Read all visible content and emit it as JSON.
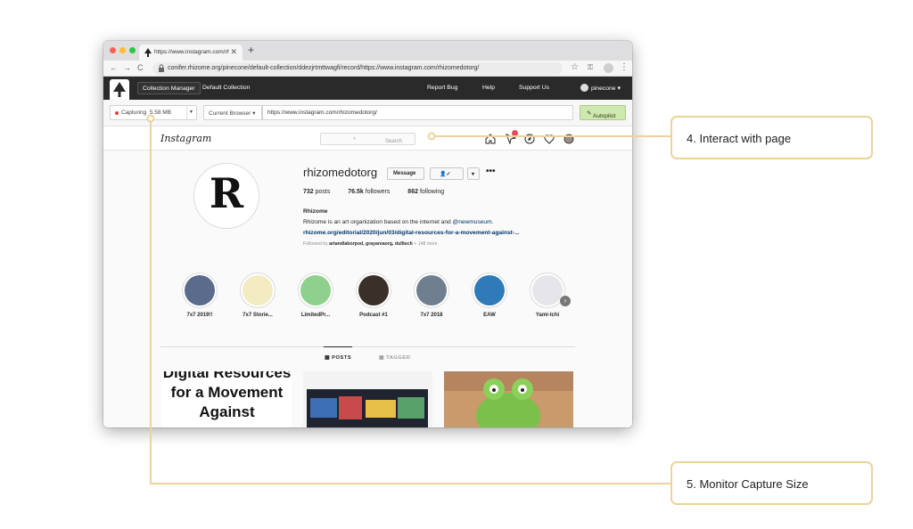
{
  "browser": {
    "tab_title": "https://www.instagram.com/rh",
    "tab_close": "✕",
    "new_tab": "+",
    "address": "conifer.rhizome.org/pinecone/default-collection/ddezjrtmttwagfi/record/https://www.instagram.com/rhizomedotorg/",
    "nav": {
      "back": "←",
      "forward": "→",
      "reload": "C"
    },
    "menu": "⋮"
  },
  "conifer": {
    "collection_manager": "Collection Manager",
    "default_collection": "Default Collection",
    "report_bug": "Report Bug",
    "help": "Help",
    "support_us": "Support Us",
    "user": "pinecone ▾",
    "capturing": "Capturing",
    "capture_size": "5.58 MB",
    "browser_select": "Current Browser ▾",
    "record_url": "https://www.instagram.com/rhizomedotorg/",
    "autopilot": "Autopilot"
  },
  "instagram": {
    "logo": "Instagram",
    "search_placeholder": "Search",
    "avatar_letter": "R",
    "username": "rhizomedotorg",
    "message_button": "Message",
    "follow_glyph": "👤✓",
    "dropdown_glyph": "▾",
    "more": "•••",
    "posts_count": "732",
    "posts_label": "posts",
    "followers_count": "76.5k",
    "followers_label": "followers",
    "following_count": "862",
    "following_label": "following",
    "bio_name": "Rhizome",
    "bio_text": "Rhizome is an art organization based on the internet and ",
    "bio_mention": "@newmuseum.",
    "bio_link": "rhizome.org/editorial/2020/jun/03/digital-resources-for-a-movement-against-...",
    "followed_prefix": "Followed by ",
    "followed_names": "artandlaborpod, grayareaorg, dulltech",
    "followed_more": " + 148 more",
    "highlights": [
      {
        "label": "7x7 2019!!",
        "color": "#5a6b8c"
      },
      {
        "label": "7x7 Storie...",
        "color": "#f3ecc0"
      },
      {
        "label": "LimitedPr...",
        "color": "#8fd18c"
      },
      {
        "label": "Podcast #1",
        "color": "#3b2f2a"
      },
      {
        "label": "7x7 2018",
        "color": "#6f7f8f"
      },
      {
        "label": "EAW",
        "color": "#2f7ab8"
      },
      {
        "label": "Yami-Ichi",
        "color": "#e6e6ea"
      }
    ],
    "tab_posts": "POSTS",
    "tab_tagged": "TAGGED",
    "post1_text": "Digital Resources for a Movement Against"
  },
  "callouts": {
    "interact": "4. Interact with page",
    "monitor": "5. Monitor Capture Size"
  },
  "colors": {
    "callout_border": "#ecd39a",
    "autopilot_bg": "#cfe8b0",
    "conifer_bar": "#2a2a2a",
    "link_blue": "#003569"
  }
}
